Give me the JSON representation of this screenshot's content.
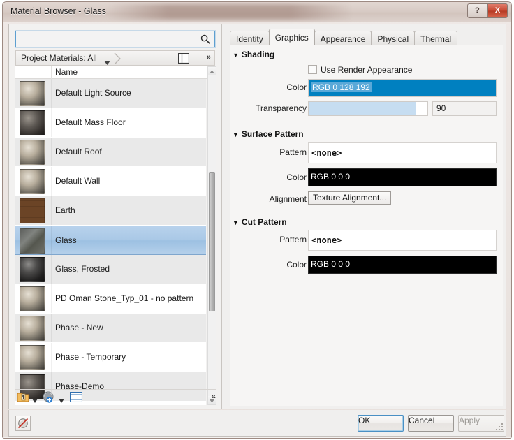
{
  "window": {
    "title": "Material Browser - Glass",
    "help_label": "?",
    "close_label": "X"
  },
  "left_panel": {
    "search": {
      "value": "",
      "placeholder": "",
      "icon": "search-icon"
    },
    "breadcrumb": {
      "label": "Project Materials: All",
      "expand_label": "»"
    },
    "list_header": {
      "name": "Name"
    },
    "materials": [
      {
        "name": "Default Light Source",
        "thumb": "sphere-light",
        "selected": false
      },
      {
        "name": "Default Mass Floor",
        "thumb": "sphere-dark",
        "selected": false
      },
      {
        "name": "Default Roof",
        "thumb": "sphere-light",
        "selected": false
      },
      {
        "name": "Default Wall",
        "thumb": "sphere-light",
        "selected": false
      },
      {
        "name": "Earth",
        "thumb": "earth",
        "selected": false
      },
      {
        "name": "Glass",
        "thumb": "glass",
        "selected": true
      },
      {
        "name": "Glass, Frosted",
        "thumb": "frosted",
        "selected": false
      },
      {
        "name": "PD Oman Stone_Typ_01 - no pattern",
        "thumb": "sphere-light",
        "selected": false
      },
      {
        "name": "Phase - New",
        "thumb": "sphere-light",
        "selected": false
      },
      {
        "name": "Phase - Temporary",
        "thumb": "sphere-light",
        "selected": false
      },
      {
        "name": "Phase-Demo",
        "thumb": "sphere-dark",
        "selected": false
      }
    ],
    "toolbar": {
      "new_material_label": "new-material-icon",
      "new_library_label": "new-library-icon",
      "show_panel_label": "library-panel-icon",
      "collapse_label": "«"
    }
  },
  "right_panel": {
    "tabs": [
      {
        "label": "Identity",
        "active": false
      },
      {
        "label": "Graphics",
        "active": true
      },
      {
        "label": "Appearance",
        "active": false
      },
      {
        "label": "Physical",
        "active": false
      },
      {
        "label": "Thermal",
        "active": false
      }
    ],
    "shading": {
      "heading": "Shading",
      "use_render_appearance_label": "Use Render Appearance",
      "use_render_appearance_checked": false,
      "color_label": "Color",
      "color_value": "RGB 0 128 192",
      "color_hex": "#0080C0",
      "transparency_label": "Transparency",
      "transparency_value": "90",
      "transparency_percent": 90
    },
    "surface_pattern": {
      "heading": "Surface Pattern",
      "pattern_label": "Pattern",
      "pattern_value": "<none>",
      "color_label": "Color",
      "color_value": "RGB 0 0 0",
      "color_hex": "#000000",
      "alignment_label": "Alignment",
      "alignment_button": "Texture Alignment..."
    },
    "cut_pattern": {
      "heading": "Cut Pattern",
      "pattern_label": "Pattern",
      "pattern_value": "<none>",
      "color_label": "Color",
      "color_value": "RGB 0 0 0",
      "color_hex": "#000000"
    }
  },
  "footer": {
    "render_badge": "no-render-appearance-icon",
    "ok_label": "OK",
    "cancel_label": "Cancel",
    "apply_label": "Apply"
  }
}
